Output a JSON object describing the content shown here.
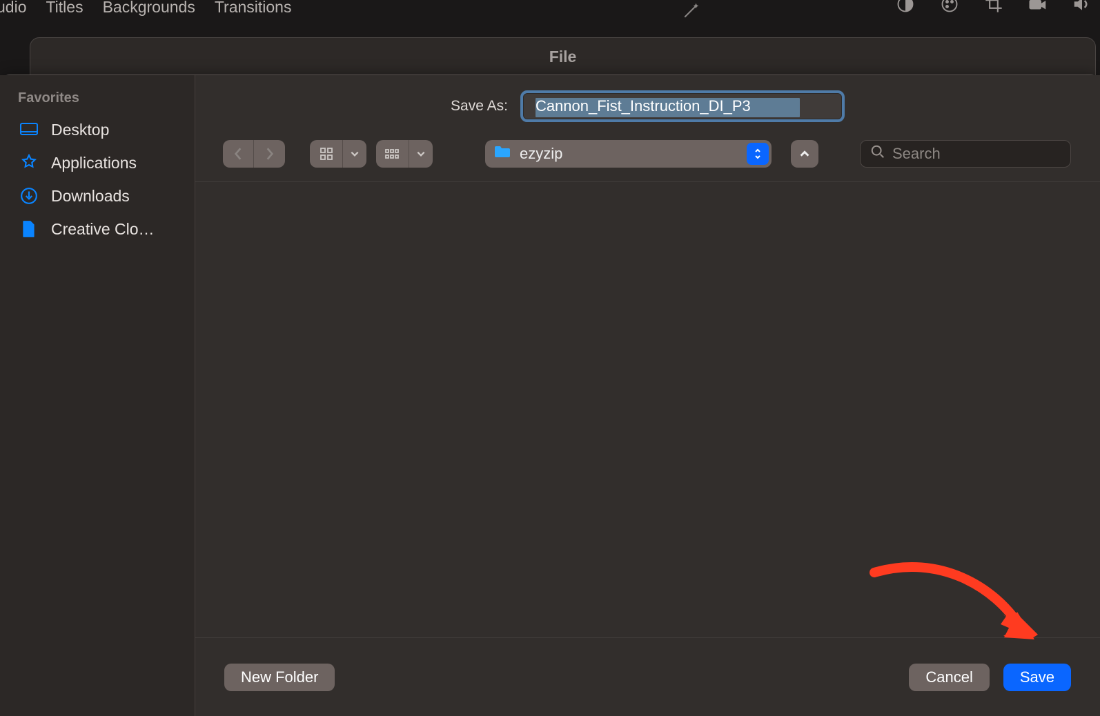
{
  "background_app": {
    "menu_items": [
      "udio",
      "Titles",
      "Backgrounds",
      "Transitions"
    ]
  },
  "window": {
    "title": "File"
  },
  "save_dialog": {
    "save_as_label": "Save As:",
    "filename": "Cannon_Fist_Instruction_DI_P3",
    "current_folder": "ezyzip",
    "search_placeholder": "Search"
  },
  "sidebar": {
    "heading": "Favorites",
    "items": [
      {
        "label": "Desktop",
        "icon": "desktop"
      },
      {
        "label": "Applications",
        "icon": "apps"
      },
      {
        "label": "Downloads",
        "icon": "downloads"
      },
      {
        "label": "Creative Clo…",
        "icon": "file"
      }
    ]
  },
  "footer": {
    "new_folder": "New Folder",
    "cancel": "Cancel",
    "save": "Save"
  }
}
